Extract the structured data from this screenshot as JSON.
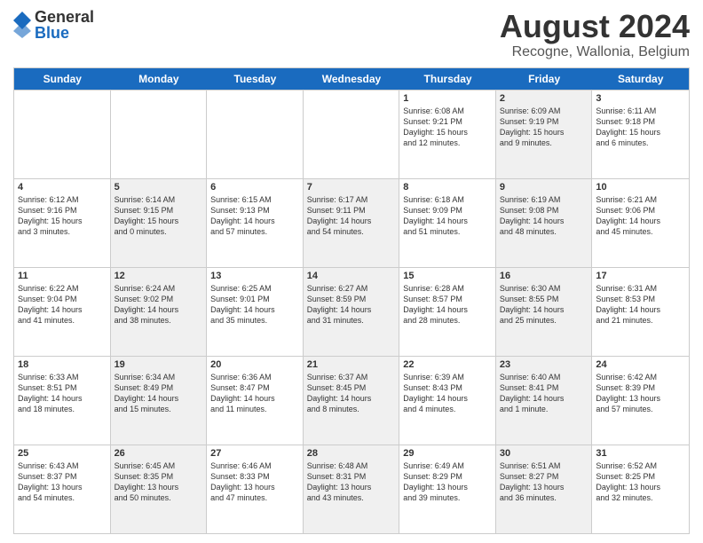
{
  "logo": {
    "general": "General",
    "blue": "Blue"
  },
  "title": "August 2024",
  "location": "Recogne, Wallonia, Belgium",
  "days_of_week": [
    "Sunday",
    "Monday",
    "Tuesday",
    "Wednesday",
    "Thursday",
    "Friday",
    "Saturday"
  ],
  "weeks": [
    [
      {
        "day": "",
        "info": "",
        "shaded": false
      },
      {
        "day": "",
        "info": "",
        "shaded": false
      },
      {
        "day": "",
        "info": "",
        "shaded": false
      },
      {
        "day": "",
        "info": "",
        "shaded": false
      },
      {
        "day": "1",
        "info": "Sunrise: 6:08 AM\nSunset: 9:21 PM\nDaylight: 15 hours\nand 12 minutes.",
        "shaded": false
      },
      {
        "day": "2",
        "info": "Sunrise: 6:09 AM\nSunset: 9:19 PM\nDaylight: 15 hours\nand 9 minutes.",
        "shaded": true
      },
      {
        "day": "3",
        "info": "Sunrise: 6:11 AM\nSunset: 9:18 PM\nDaylight: 15 hours\nand 6 minutes.",
        "shaded": false
      }
    ],
    [
      {
        "day": "4",
        "info": "Sunrise: 6:12 AM\nSunset: 9:16 PM\nDaylight: 15 hours\nand 3 minutes.",
        "shaded": false
      },
      {
        "day": "5",
        "info": "Sunrise: 6:14 AM\nSunset: 9:15 PM\nDaylight: 15 hours\nand 0 minutes.",
        "shaded": true
      },
      {
        "day": "6",
        "info": "Sunrise: 6:15 AM\nSunset: 9:13 PM\nDaylight: 14 hours\nand 57 minutes.",
        "shaded": false
      },
      {
        "day": "7",
        "info": "Sunrise: 6:17 AM\nSunset: 9:11 PM\nDaylight: 14 hours\nand 54 minutes.",
        "shaded": true
      },
      {
        "day": "8",
        "info": "Sunrise: 6:18 AM\nSunset: 9:09 PM\nDaylight: 14 hours\nand 51 minutes.",
        "shaded": false
      },
      {
        "day": "9",
        "info": "Sunrise: 6:19 AM\nSunset: 9:08 PM\nDaylight: 14 hours\nand 48 minutes.",
        "shaded": true
      },
      {
        "day": "10",
        "info": "Sunrise: 6:21 AM\nSunset: 9:06 PM\nDaylight: 14 hours\nand 45 minutes.",
        "shaded": false
      }
    ],
    [
      {
        "day": "11",
        "info": "Sunrise: 6:22 AM\nSunset: 9:04 PM\nDaylight: 14 hours\nand 41 minutes.",
        "shaded": false
      },
      {
        "day": "12",
        "info": "Sunrise: 6:24 AM\nSunset: 9:02 PM\nDaylight: 14 hours\nand 38 minutes.",
        "shaded": true
      },
      {
        "day": "13",
        "info": "Sunrise: 6:25 AM\nSunset: 9:01 PM\nDaylight: 14 hours\nand 35 minutes.",
        "shaded": false
      },
      {
        "day": "14",
        "info": "Sunrise: 6:27 AM\nSunset: 8:59 PM\nDaylight: 14 hours\nand 31 minutes.",
        "shaded": true
      },
      {
        "day": "15",
        "info": "Sunrise: 6:28 AM\nSunset: 8:57 PM\nDaylight: 14 hours\nand 28 minutes.",
        "shaded": false
      },
      {
        "day": "16",
        "info": "Sunrise: 6:30 AM\nSunset: 8:55 PM\nDaylight: 14 hours\nand 25 minutes.",
        "shaded": true
      },
      {
        "day": "17",
        "info": "Sunrise: 6:31 AM\nSunset: 8:53 PM\nDaylight: 14 hours\nand 21 minutes.",
        "shaded": false
      }
    ],
    [
      {
        "day": "18",
        "info": "Sunrise: 6:33 AM\nSunset: 8:51 PM\nDaylight: 14 hours\nand 18 minutes.",
        "shaded": false
      },
      {
        "day": "19",
        "info": "Sunrise: 6:34 AM\nSunset: 8:49 PM\nDaylight: 14 hours\nand 15 minutes.",
        "shaded": true
      },
      {
        "day": "20",
        "info": "Sunrise: 6:36 AM\nSunset: 8:47 PM\nDaylight: 14 hours\nand 11 minutes.",
        "shaded": false
      },
      {
        "day": "21",
        "info": "Sunrise: 6:37 AM\nSunset: 8:45 PM\nDaylight: 14 hours\nand 8 minutes.",
        "shaded": true
      },
      {
        "day": "22",
        "info": "Sunrise: 6:39 AM\nSunset: 8:43 PM\nDaylight: 14 hours\nand 4 minutes.",
        "shaded": false
      },
      {
        "day": "23",
        "info": "Sunrise: 6:40 AM\nSunset: 8:41 PM\nDaylight: 14 hours\nand 1 minute.",
        "shaded": true
      },
      {
        "day": "24",
        "info": "Sunrise: 6:42 AM\nSunset: 8:39 PM\nDaylight: 13 hours\nand 57 minutes.",
        "shaded": false
      }
    ],
    [
      {
        "day": "25",
        "info": "Sunrise: 6:43 AM\nSunset: 8:37 PM\nDaylight: 13 hours\nand 54 minutes.",
        "shaded": false
      },
      {
        "day": "26",
        "info": "Sunrise: 6:45 AM\nSunset: 8:35 PM\nDaylight: 13 hours\nand 50 minutes.",
        "shaded": true
      },
      {
        "day": "27",
        "info": "Sunrise: 6:46 AM\nSunset: 8:33 PM\nDaylight: 13 hours\nand 47 minutes.",
        "shaded": false
      },
      {
        "day": "28",
        "info": "Sunrise: 6:48 AM\nSunset: 8:31 PM\nDaylight: 13 hours\nand 43 minutes.",
        "shaded": true
      },
      {
        "day": "29",
        "info": "Sunrise: 6:49 AM\nSunset: 8:29 PM\nDaylight: 13 hours\nand 39 minutes.",
        "shaded": false
      },
      {
        "day": "30",
        "info": "Sunrise: 6:51 AM\nSunset: 8:27 PM\nDaylight: 13 hours\nand 36 minutes.",
        "shaded": true
      },
      {
        "day": "31",
        "info": "Sunrise: 6:52 AM\nSunset: 8:25 PM\nDaylight: 13 hours\nand 32 minutes.",
        "shaded": false
      }
    ]
  ]
}
